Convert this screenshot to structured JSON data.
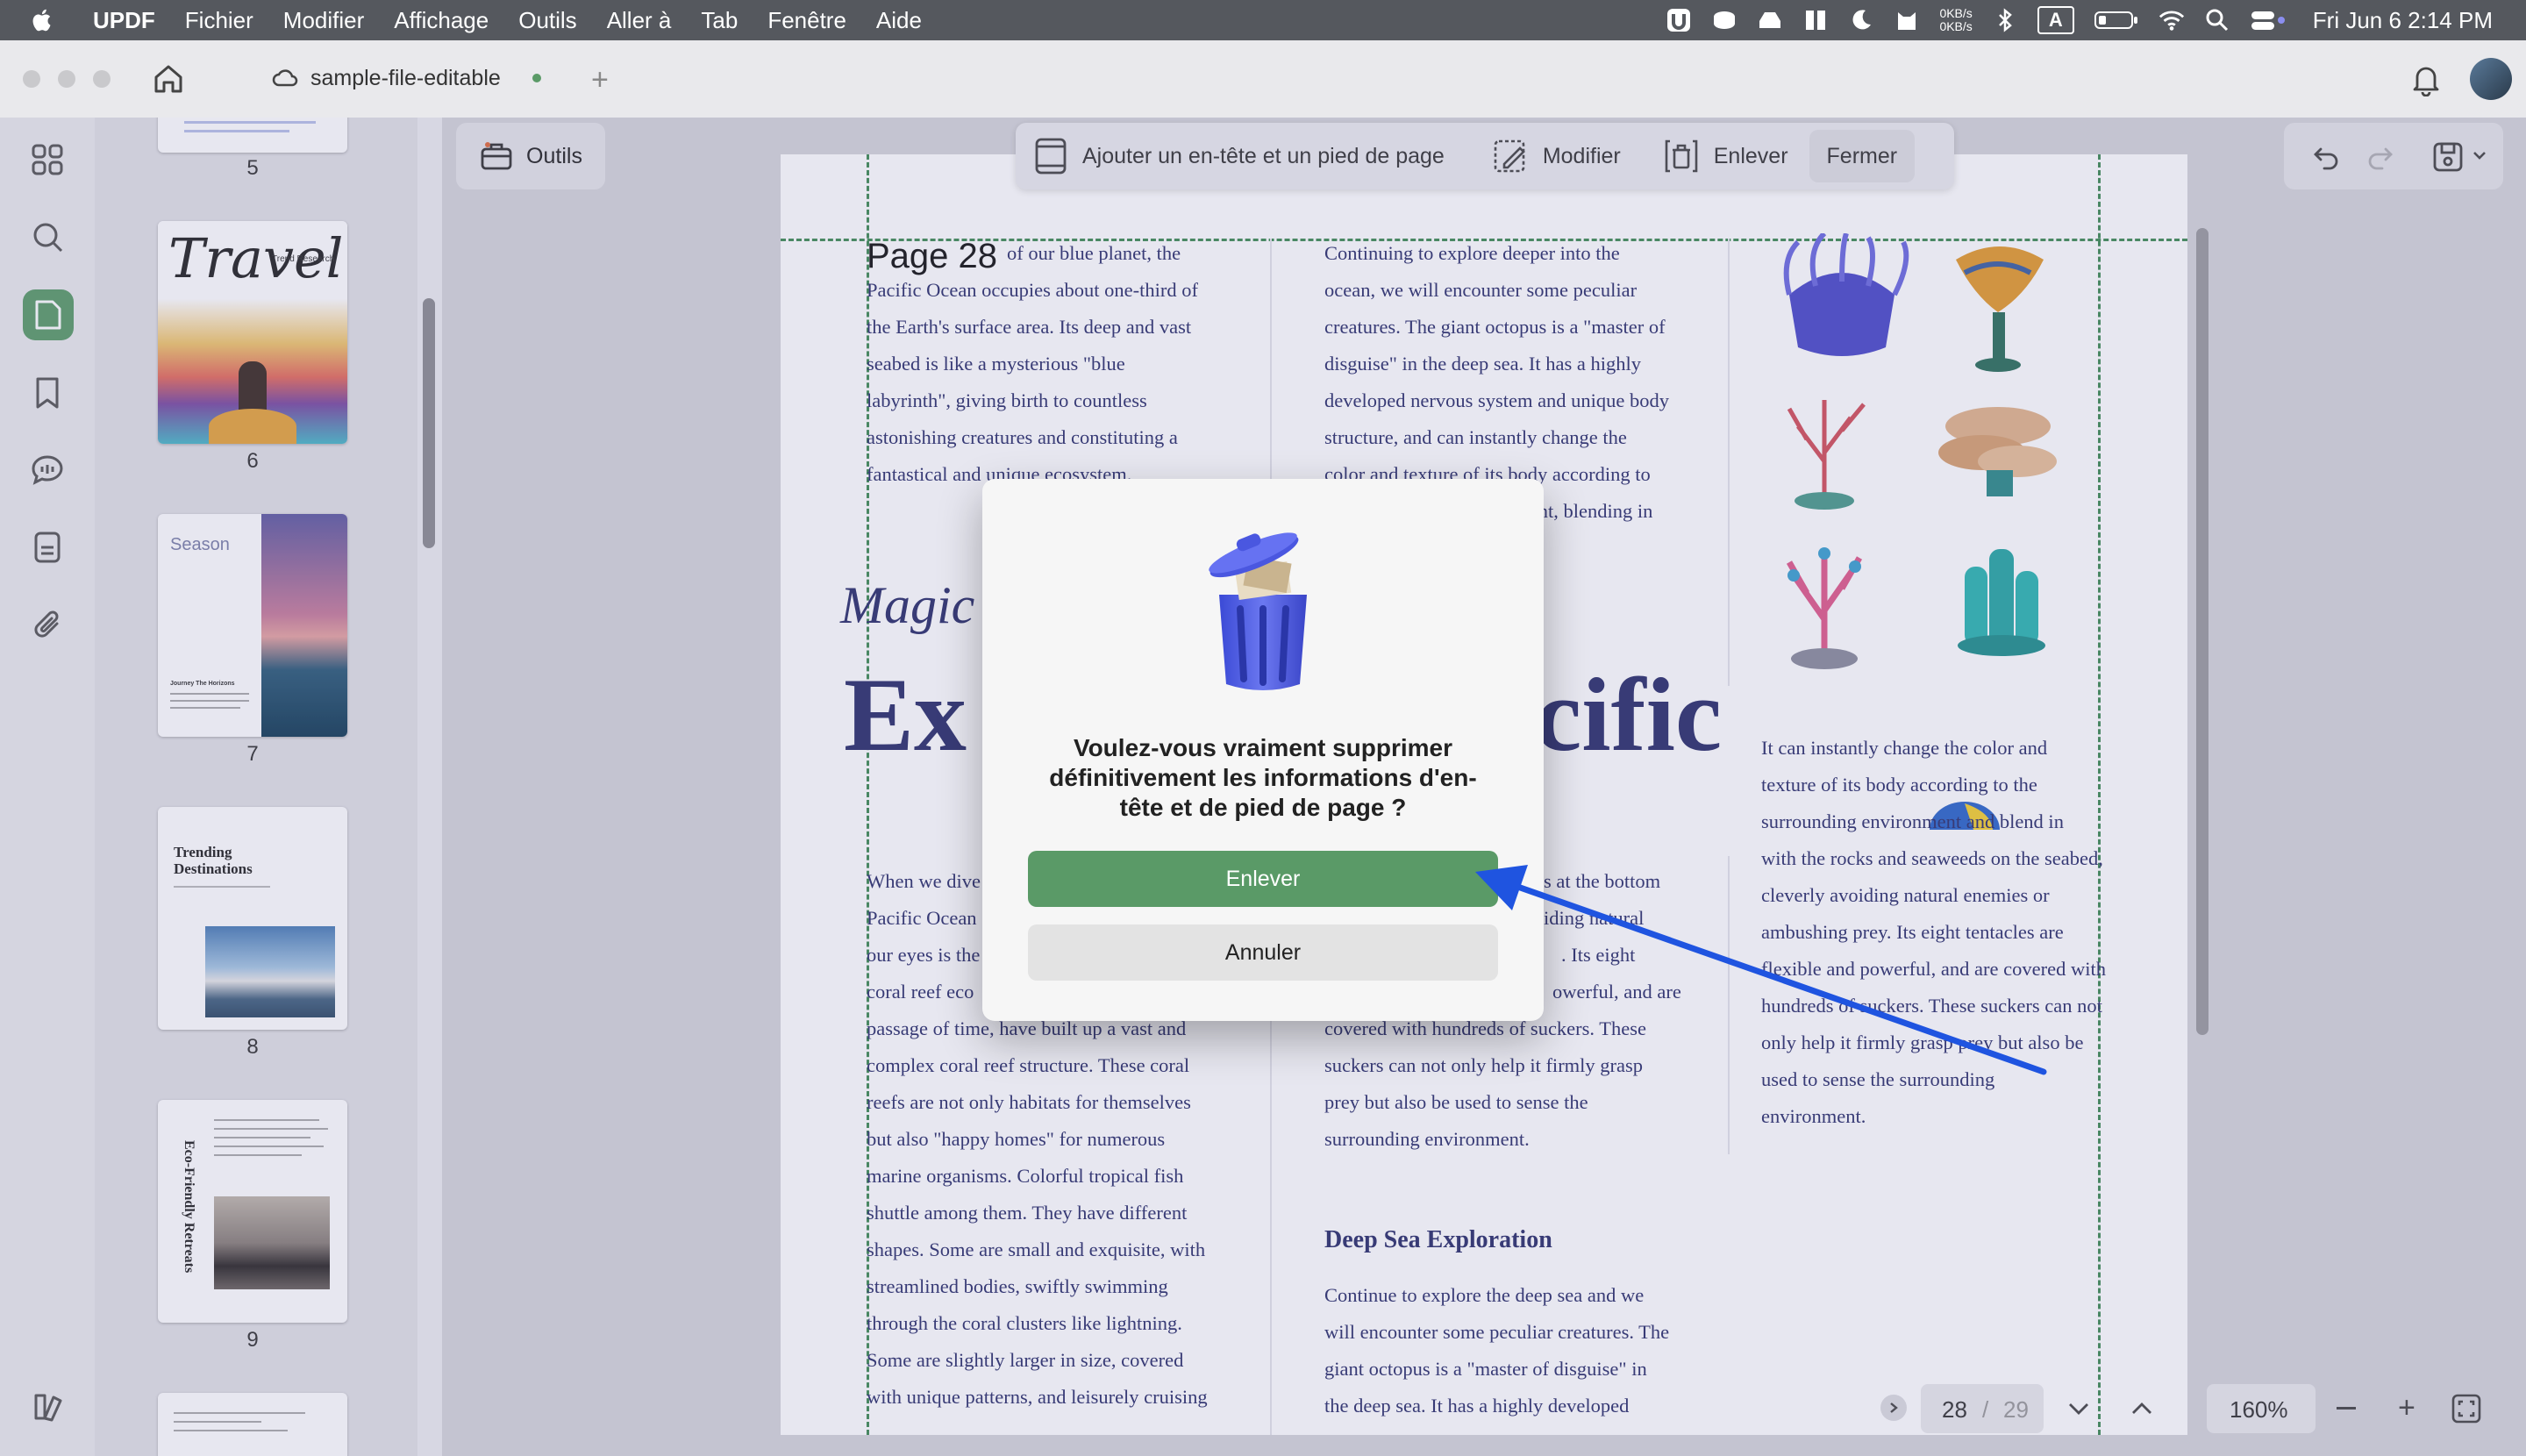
{
  "menubar": {
    "app_name": "UPDF",
    "items": [
      "Fichier",
      "Modifier",
      "Affichage",
      "Outils",
      "Aller à",
      "Tab",
      "Fenêtre",
      "Aide"
    ],
    "net_up": "0KB/s",
    "net_down": "0KB/s",
    "input_label": "A",
    "clock": "Fri Jun 6  2:14 PM"
  },
  "titlebar": {
    "tab_title": "sample-file-editable"
  },
  "sidebar": {
    "icons": [
      "thumbnails-icon",
      "search-icon",
      "pages-icon",
      "bookmark-icon",
      "comment-icon",
      "form-icon",
      "attachment-icon"
    ],
    "thumbnails": [
      {
        "label": "5"
      },
      {
        "label": "6",
        "title": "Travel",
        "subtitle": "Trend Research"
      },
      {
        "label": "7",
        "title": "Season",
        "subtitle": "Journey The Horizons"
      },
      {
        "label": "8",
        "title": "Trending Destinations"
      },
      {
        "label": "9",
        "title": "Eco-Friendly Retreats"
      }
    ]
  },
  "toolbar": {
    "tools_label": "Outils",
    "add_header_footer": "Ajouter un en-tête et un pied de page",
    "modify": "Modifier",
    "remove": "Enlever",
    "close": "Fermer"
  },
  "document": {
    "page_label": "Page 28",
    "col1_top": [
      "of our blue planet, the",
      "Pacific Ocean occupies about one-third of",
      "the Earth's surface area. Its deep and vast",
      "seabed is like a mysterious \"blue",
      "labyrinth\", giving birth to countless",
      "astonishing creatures and constituting a",
      "fantastical and unique ecosystem."
    ],
    "col2_top": [
      "Continuing to explore deeper into the",
      "ocean, we will encounter some peculiar",
      "creatures. The giant octopus is a \"master of",
      "disguise\" in the deep sea. It has a highly",
      "developed nervous system and unique body",
      "structure, and can instantly change the",
      "color and texture of its body according to",
      "the surrounding environment, blending in"
    ],
    "heading_small": "Magic",
    "heading_big_left": "Ex",
    "heading_big_right": "cific",
    "col1_bottom": [
      "When we dive",
      "Pacific Ocean",
      "our eyes is the",
      "coral reef eco",
      "passage of time, have built up a vast and",
      "complex coral reef structure. These coral",
      "reefs are not only habitats for themselves",
      "but also \"happy homes\" for numerous",
      "marine organisms. Colorful tropical fish",
      "shuttle among them. They have different",
      "shapes. Some are small and exquisite, with",
      "streamlined bodies, swiftly swimming",
      "through the coral clusters like lightning.",
      "Some are slightly larger in size, covered",
      "with unique patterns, and leisurely cruising"
    ],
    "col2_mid": [
      "s at the bottom",
      "iding natural",
      ". Its eight",
      "owerful, and are",
      "covered with hundreds of suckers. These",
      "suckers can not only help it firmly grasp",
      "prey but also be used to sense the",
      "surrounding environment."
    ],
    "col2_heading": "Deep Sea Exploration",
    "col2_bottom": [
      "Continue to explore the deep sea and we",
      "will encounter some peculiar creatures. The",
      "giant octopus is a \"master of disguise\" in",
      "the deep sea. It has a highly developed"
    ],
    "col3": [
      "It can instantly change the color and",
      "texture of its body according to the",
      "surrounding environment and blend in",
      "with the rocks and seaweeds on the seabed,",
      "cleverly avoiding natural enemies or",
      "ambushing prey. Its eight tentacles are",
      "flexible and powerful, and are covered with",
      "hundreds of suckers. These suckers can not",
      "only help it firmly grasp prey but also be",
      "used to sense the surrounding",
      "environment."
    ]
  },
  "dialog": {
    "message": "Voulez-vous vraiment supprimer définitivement les informations d'en-tête et de pied de page ?",
    "confirm": "Enlever",
    "cancel": "Annuler"
  },
  "pagenav": {
    "current_page": "28",
    "separator": "/",
    "total_pages": "29",
    "zoom": "160%"
  },
  "colors": {
    "accent_green": "#5a9a67",
    "annotation_arrow": "#1f54e0",
    "text_navy": "#2a2e6b"
  }
}
